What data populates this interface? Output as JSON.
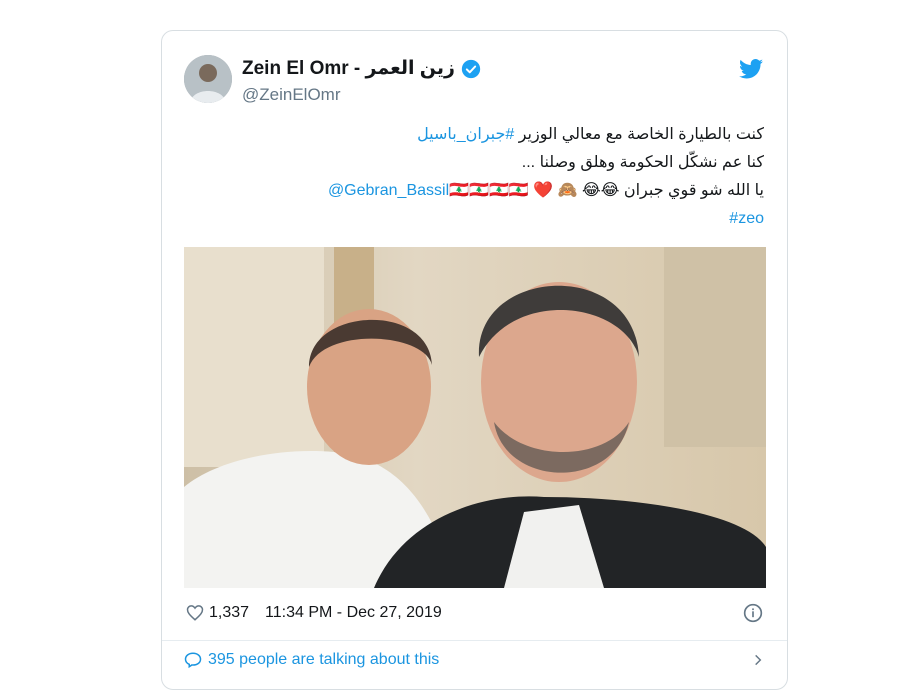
{
  "tweet": {
    "display_name": "Zein El Omr - زين العمر",
    "handle": "@ZeinElOmr",
    "lines": {
      "line1_text": "كنت بالطيارة الخاصة مع معالي الوزير ",
      "line1_hashtag": "#جبران_باسيل",
      "line2_text": "كنا عم نشكّل الحكومة وهلق وصلنا ...",
      "line3_text": "يا الله شو قوي جبران ",
      "line3_emojis": "😂😂 🙈 ❤️",
      "line3_flags": "🇱🇧🇱🇧🇱🇧🇱🇧",
      "line3_mention": "@Gebran_Bassil",
      "line4_hashtag": "#zeo"
    },
    "likes": "1,337",
    "timestamp": "11:34 PM - Dec 27, 2019",
    "talking": "395 people are talking about this"
  },
  "icons": {
    "bird": "twitter-bird-icon",
    "verified": "verified-badge-icon",
    "heart": "heart-icon",
    "info": "info-icon",
    "reply": "comment-icon",
    "chevron": "chevron-right-icon"
  },
  "colors": {
    "accent": "#1b95e0",
    "secondary_text": "#657786",
    "border": "#d8dee2"
  }
}
